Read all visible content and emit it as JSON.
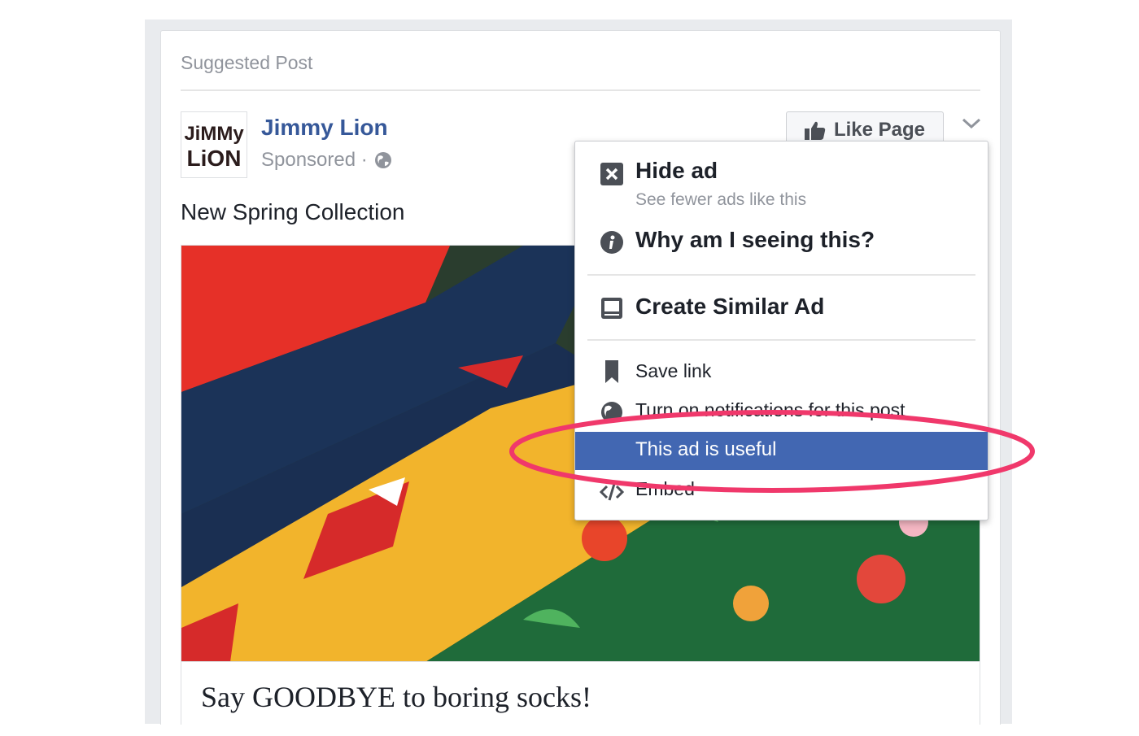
{
  "card": {
    "header": "Suggested Post",
    "page_name": "Jimmy Lion",
    "logo_line1": "JiMMy",
    "logo_line2": "LiON",
    "sponsored": "Sponsored · ",
    "like_page_label": "Like Page",
    "post_text": "New Spring Collection",
    "link_title": "Say GOODBYE to boring socks!"
  },
  "menu": {
    "hide_ad": "Hide ad",
    "hide_ad_sub": "See fewer ads like this",
    "why": "Why am I seeing this?",
    "create_similar": "Create Similar Ad",
    "save_link": "Save link",
    "notifications": "Turn on notifications for this post",
    "useful": "This ad is useful",
    "embed": "Embed"
  },
  "icons": {
    "hide": "close-box-icon",
    "why": "info-icon",
    "create": "monitor-icon",
    "save": "bookmark-icon",
    "notifications": "globe-icon",
    "embed": "code-icon",
    "like": "thumbs-up-icon",
    "more": "chevron-down-icon"
  },
  "colors": {
    "link_blue": "#365899",
    "highlight_blue": "#4267b2",
    "annotation_pink": "#f0386b"
  }
}
